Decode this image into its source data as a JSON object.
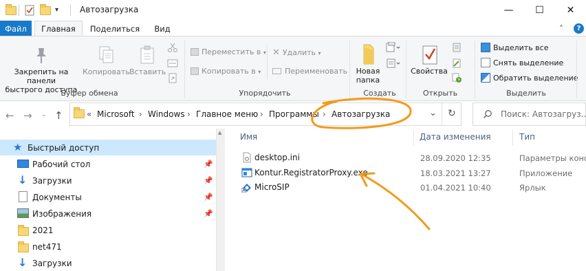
{
  "window": {
    "title": "Автозагрузка",
    "controls": {
      "minimize": "—",
      "maximize": "☐",
      "close": "✕"
    }
  },
  "quick_access_toolbar": {
    "customize": "▾"
  },
  "ribbon_tabs": [
    {
      "label": "Файл"
    },
    {
      "label": "Главная"
    },
    {
      "label": "Поделиться"
    },
    {
      "label": "Вид"
    }
  ],
  "ribbon_help": "?",
  "ribbon_collapse": "˄",
  "ribbon": {
    "clipboard": {
      "pin_label_1": "Закрепить на панели",
      "pin_label_2": "быстрого доступа",
      "copy": "Копировать",
      "paste": "Вставить",
      "group": "Буфер обмена"
    },
    "organize": {
      "move_to": "Переместить в",
      "copy_to": "Копировать в",
      "delete": "Удалить",
      "rename": "Переименовать",
      "group": "Упорядочить"
    },
    "new": {
      "new_folder_1": "Новая",
      "new_folder_2": "папка",
      "group": "Создать"
    },
    "open": {
      "properties": "Свойства",
      "group": "Открыть"
    },
    "select": {
      "select_all": "Выделить все",
      "select_none": "Снять выделение",
      "invert": "Обратить выделение",
      "group": "Выделить"
    }
  },
  "address_bar": {
    "overflow": "«",
    "crumbs": [
      "Microsoft",
      "Windows",
      "Главное меню",
      "Программы",
      "Автозагрузка"
    ],
    "dropdown": "⌄",
    "refresh": "↻"
  },
  "search": {
    "placeholder": "Поиск: Автозагруз..."
  },
  "nav_pane": {
    "items": [
      {
        "label": "Быстрый доступ",
        "icon": "star-icon",
        "pinned": false
      },
      {
        "label": "Рабочий стол",
        "icon": "desktop-icon",
        "pinned": true
      },
      {
        "label": "Загрузки",
        "icon": "download-icon",
        "pinned": true
      },
      {
        "label": "Документы",
        "icon": "documents-icon",
        "pinned": true
      },
      {
        "label": "Изображения",
        "icon": "pictures-icon",
        "pinned": true
      },
      {
        "label": "2021",
        "icon": "folder-icon",
        "pinned": false
      },
      {
        "label": "net471",
        "icon": "folder-icon",
        "pinned": false
      },
      {
        "label": "Загрузки",
        "icon": "download-icon",
        "pinned": false
      }
    ]
  },
  "file_list": {
    "columns": {
      "name": "Имя",
      "date": "Дата изменения",
      "type": "Тип"
    },
    "rows": [
      {
        "name": "desktop.ini",
        "date": "28.09.2020 12:35",
        "type": "Параметры конф...",
        "icon": "settings-file-icon"
      },
      {
        "name": "Kontur.RegistratorProxy.exe",
        "date": "18.03.2021 13:27",
        "type": "Приложение",
        "icon": "exe-icon"
      },
      {
        "name": "MicroSIP",
        "date": "01.04.2021 10:40",
        "type": "Ярлык",
        "icon": "shortcut-icon"
      }
    ]
  },
  "colors": {
    "accent": "#1979ca",
    "selection": "#cce8ff",
    "annotation": "#f29a1b",
    "folder": "#f8d776"
  }
}
